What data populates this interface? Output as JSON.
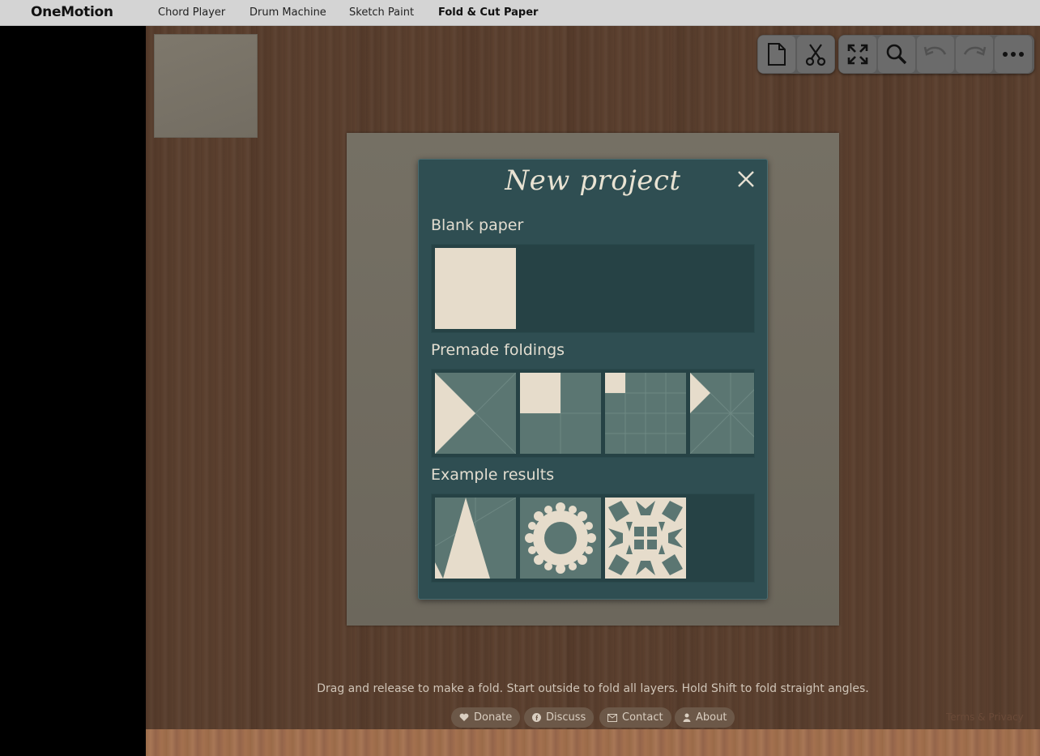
{
  "brand": "OneMotion",
  "nav": [
    {
      "label": "Chord Player",
      "active": false
    },
    {
      "label": "Drum Machine",
      "active": false
    },
    {
      "label": "Sketch Paint",
      "active": false
    },
    {
      "label": "Fold & Cut Paper",
      "active": true
    }
  ],
  "toolbar": {
    "new_icon": "file-icon",
    "cut_icon": "scissors-icon",
    "fullscreen_icon": "fullscreen-icon",
    "zoom_icon": "magnifier-icon",
    "undo_icon": "undo-icon",
    "redo_icon": "redo-icon",
    "more_icon": "ellipsis-icon"
  },
  "dialog": {
    "title": "New project",
    "sections": {
      "blank": "Blank paper",
      "premade": "Premade foldings",
      "examples": "Example results"
    }
  },
  "hint": "Drag and release to make a fold. Start outside to fold all layers. Hold Shift to fold straight angles.",
  "footer": {
    "donate": "Donate",
    "discuss": "Discuss",
    "contact": "Contact",
    "about": "About",
    "terms": "Terms & Privacy"
  },
  "colors": {
    "dialog_bg": "#2f4e52",
    "paper_cream": "#e6dccb",
    "tile_green": "#5b7672"
  }
}
